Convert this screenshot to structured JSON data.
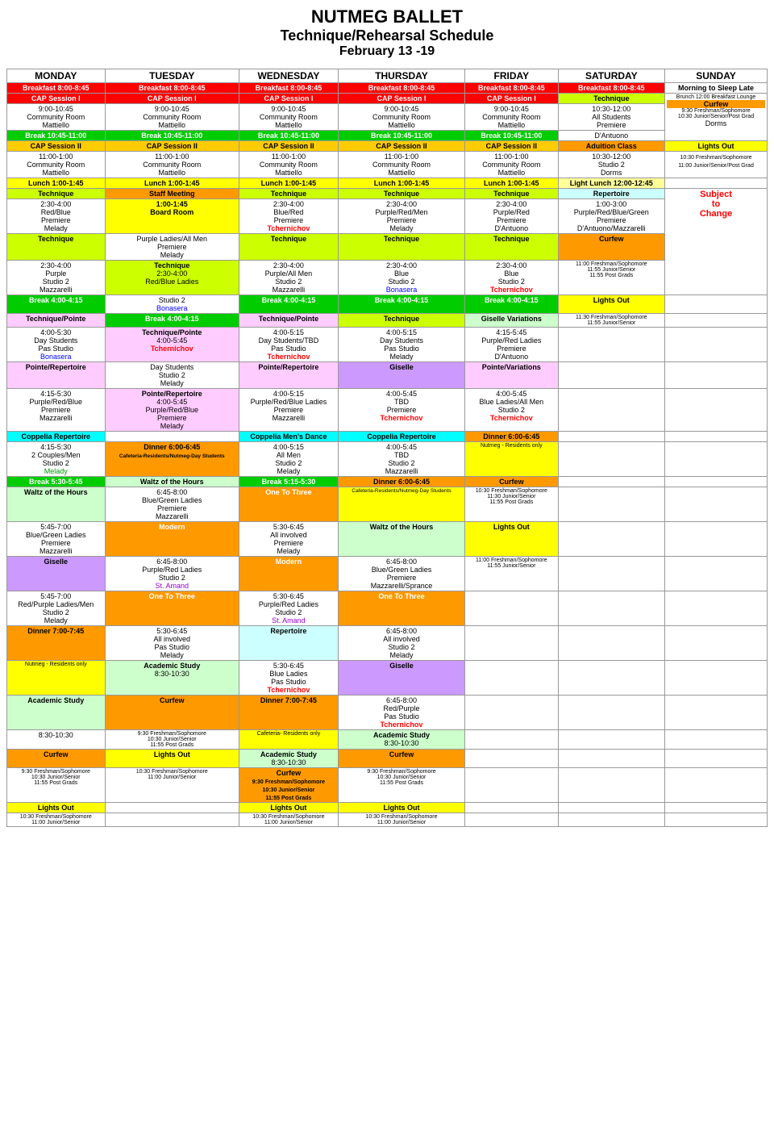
{
  "header": {
    "title": "NUTMEG BALLET",
    "subtitle": "Technique/Rehearsal Schedule",
    "date": "February 13 -19"
  },
  "days": [
    "MONDAY",
    "TUESDAY",
    "WEDNESDAY",
    "THURSDAY",
    "FRIDAY",
    "SATURDAY",
    "SUNDAY"
  ]
}
